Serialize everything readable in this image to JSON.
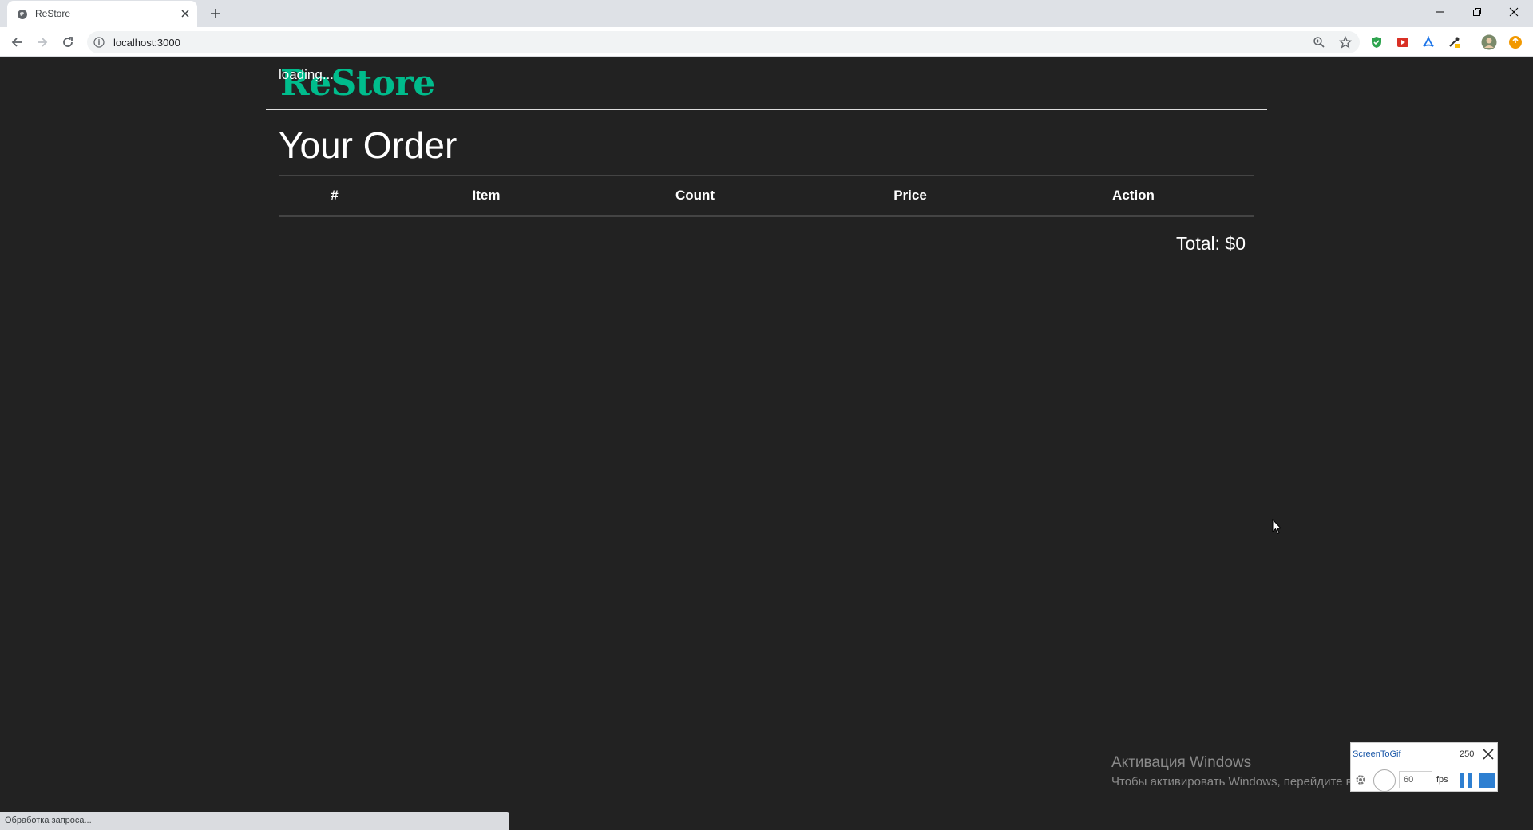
{
  "browser": {
    "tab_title": "ReStore",
    "url": "localhost:3000"
  },
  "app": {
    "logo": "ReStore",
    "loading_text": "loading...",
    "order_title": "Your Order",
    "table_headers": [
      "#",
      "Item",
      "Count",
      "Price",
      "Action"
    ],
    "total_text": "Total: $0"
  },
  "colors": {
    "background": "#222222",
    "brand": "#00bc8c",
    "text": "#ffffff"
  },
  "os_overlay": {
    "activation_title": "Активация Windows",
    "activation_sub": "Чтобы активировать Windows, перейдите в раздел \"Параметры\"."
  },
  "status_bar": {
    "text": "Обработка запроса..."
  },
  "screentogif": {
    "title": "ScreenToGif",
    "frame_count": "250",
    "fps_value": "60",
    "fps_label": "fps"
  }
}
